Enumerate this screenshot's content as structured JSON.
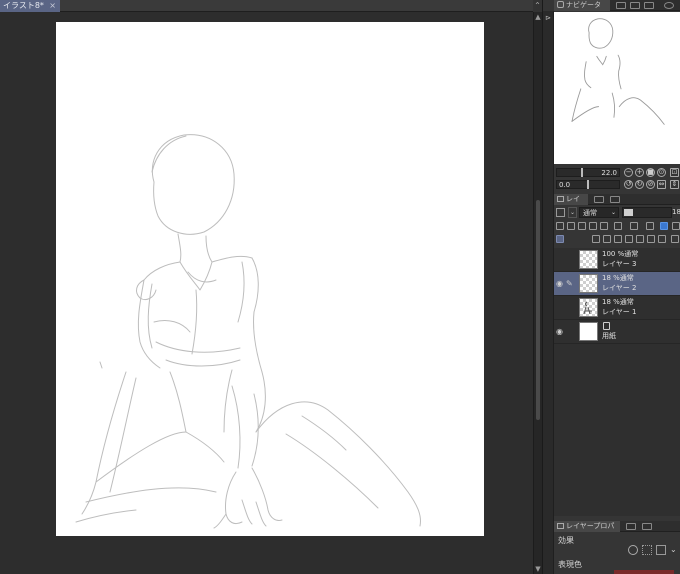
{
  "document": {
    "tab_label": "イラスト8*",
    "close_glyph": "×",
    "chevron_up": "⌃",
    "scroll_up": "▲",
    "scroll_down": "▼"
  },
  "navigator": {
    "tab_label": "ナビゲーター",
    "zoom_value": "22.0",
    "rotate_value": "0.0"
  },
  "layers_panel": {
    "tab_label": "レイヤー",
    "blend_mode": "通常",
    "opacity_value": "18",
    "layers": [
      {
        "info": "100 %通常",
        "name": "レイヤー 3",
        "selected": false,
        "visible": false
      },
      {
        "info": "18 %通常",
        "name": "レイヤー 2",
        "selected": true,
        "visible": true
      },
      {
        "info": "18 %通常",
        "name": "レイヤー 1",
        "selected": false,
        "visible": false
      },
      {
        "info": "",
        "name": "用紙",
        "selected": false,
        "visible": true
      }
    ],
    "eye_glyph": "👁",
    "pen_glyph": "✎"
  },
  "properties_panel": {
    "tab_label": "レイヤープロパティ",
    "effect_label": "効果",
    "expression_color_label": "表現色"
  },
  "colors": {
    "selected_row": "#5a6585",
    "panel_bg": "#353535",
    "canvas_bg": "#2d2d2d",
    "paper": "#ffffff"
  }
}
